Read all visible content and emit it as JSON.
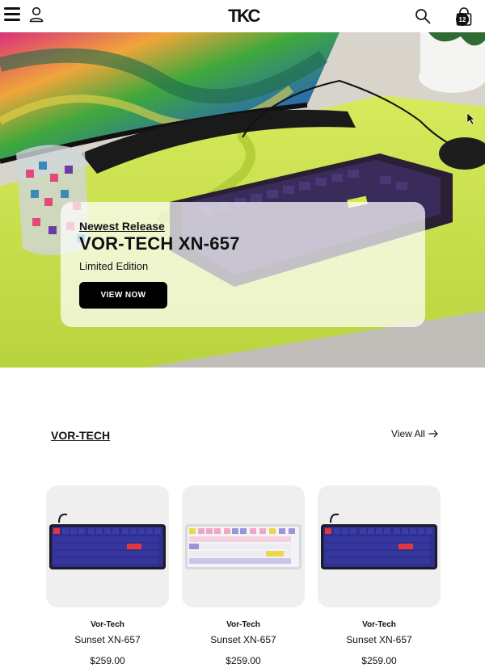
{
  "header": {
    "logo_text": "TKC",
    "cart_count": "12",
    "icons": [
      "menu-icon",
      "user-icon",
      "search-icon",
      "shopping-bag-icon"
    ]
  },
  "hero": {
    "eyebrow": "Newest Release",
    "title": "VOR-TECH XN-657",
    "subtitle": "Limited Edition",
    "button_label": "VIEW NOW"
  },
  "section": {
    "title": "VOR-TECH",
    "view_all_label": "View All"
  },
  "products": [
    {
      "brand": "Vor-Tech",
      "name": "Sunset XN-657",
      "price": "$259.00"
    },
    {
      "brand": "Vor-Tech",
      "name": "Sunset XN-657",
      "price": "$259.00"
    },
    {
      "brand": "Vor-Tech",
      "name": "Sunset XN-657",
      "price": "$259.00"
    }
  ],
  "colors": {
    "accent": "#000000",
    "desk_mat": "#c9e04a",
    "keycap_navy": "#2e2f8f",
    "card_bg": "#efefef"
  }
}
